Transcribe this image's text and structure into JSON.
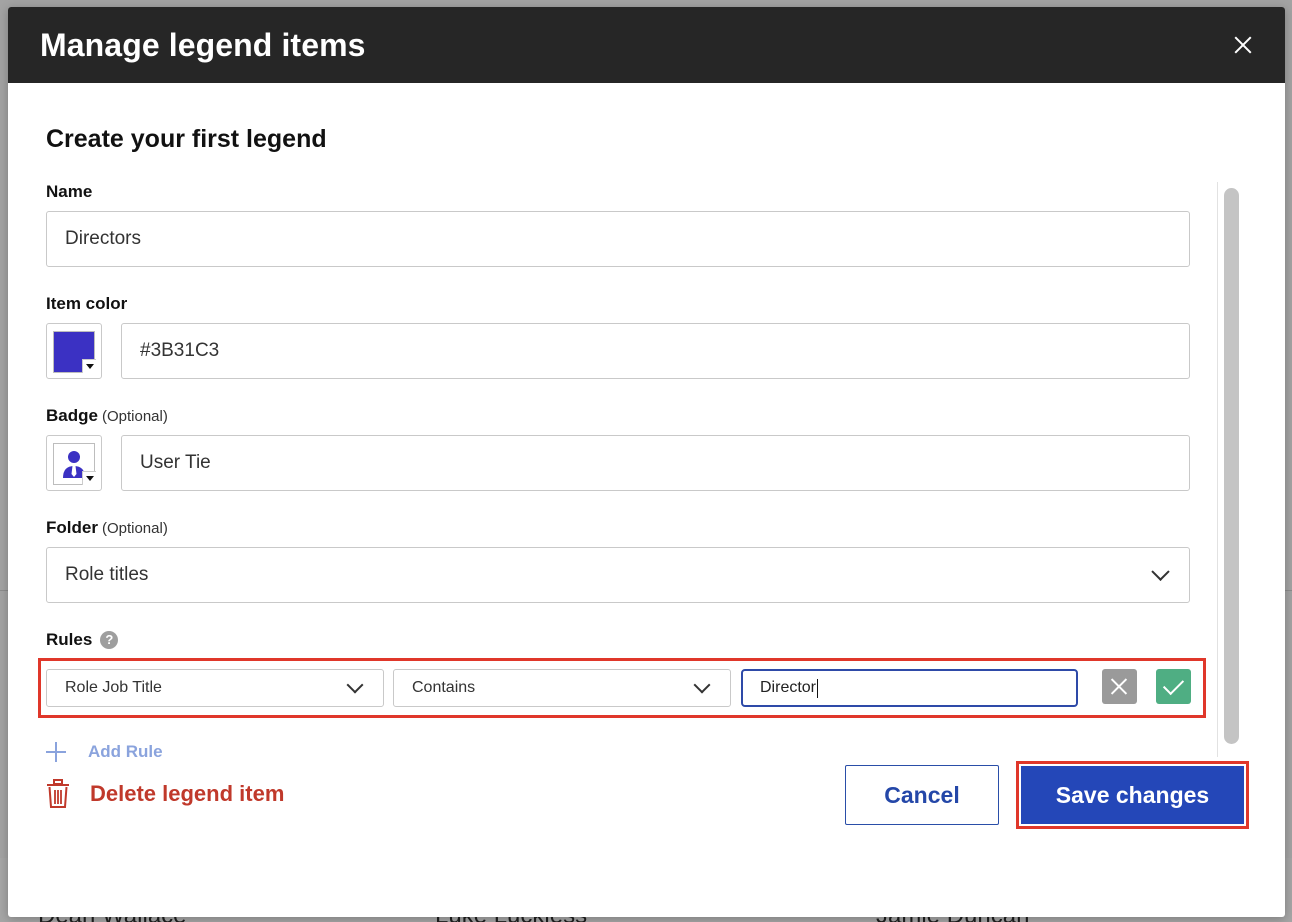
{
  "modal": {
    "title": "Manage legend items",
    "section_title": "Create your first legend"
  },
  "name_field": {
    "label": "Name",
    "value": "Directors"
  },
  "item_color": {
    "label": "Item color",
    "value": "#3B31C3",
    "swatch_color": "#3B31C3"
  },
  "badge": {
    "label": "Badge",
    "optional": "(Optional)",
    "value": "User Tie",
    "icon": "user-tie-icon"
  },
  "folder": {
    "label": "Folder",
    "optional": "(Optional)",
    "value": "Role titles"
  },
  "rules": {
    "label": "Rules",
    "help": "?",
    "field": "Role Job Title",
    "operator": "Contains",
    "value": "Director"
  },
  "actions": {
    "add_rule": "Add Rule",
    "delete_item": "Delete legend item",
    "cancel": "Cancel",
    "save": "Save changes"
  },
  "background": {
    "names": [
      "Dean Wallace",
      "Luke Luckless",
      "Jamie Duncan"
    ]
  },
  "colors": {
    "header": "#262626",
    "primary": "#2447B8",
    "danger": "#C0392B",
    "confirm": "#4FAE83",
    "highlight": "#E0372A"
  }
}
